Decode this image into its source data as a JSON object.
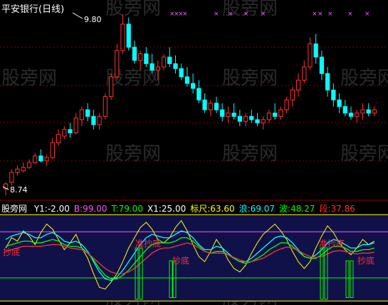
{
  "title": "平安银行(日线)",
  "price_panel": {
    "high_label": "9.80",
    "low_label": "8.74"
  },
  "indicator_panel": {
    "name": "股旁网",
    "values": [
      {
        "label": "Y1:",
        "value": "-2.00",
        "color": "#ffffff"
      },
      {
        "label": "B:",
        "value": "99.00",
        "color": "#ff55ff"
      },
      {
        "label": "T:",
        "value": "79.00",
        "color": "#00ff00"
      },
      {
        "label": "X1:",
        "value": "25.00",
        "color": "#ffffff"
      },
      {
        "label": "标尺:",
        "value": "63.60",
        "color": "#ffff00"
      },
      {
        "label": "浪:",
        "value": "69.07",
        "color": "#00ffff"
      },
      {
        "label": "波:",
        "value": "48.27",
        "color": "#00ff00"
      },
      {
        "label": "段:",
        "value": "37.86",
        "color": "#ff3030"
      }
    ],
    "annotations": [
      "抄底",
      "准抄底",
      "抄底",
      "准抄底",
      "抄底"
    ]
  },
  "watermark": "股旁网",
  "colors": {
    "up": "#ff3232",
    "down": "#00ffff",
    "grid": "#8b0000",
    "yellow": "#ffff00",
    "magenta": "#ff55ff"
  },
  "chart_data": {
    "type": "candlestick",
    "ylim": [
      8.74,
      9.8
    ],
    "candles": [
      [
        8.74,
        8.78,
        8.7,
        8.77
      ],
      [
        8.78,
        8.86,
        8.76,
        8.84
      ],
      [
        8.84,
        8.88,
        8.82,
        8.86
      ],
      [
        8.85,
        8.9,
        8.84,
        8.87
      ],
      [
        8.87,
        8.92,
        8.86,
        8.9
      ],
      [
        8.9,
        8.96,
        8.89,
        8.94
      ],
      [
        8.94,
        8.98,
        8.9,
        8.91
      ],
      [
        8.91,
        8.95,
        8.88,
        8.93
      ],
      [
        8.93,
        9.05,
        8.92,
        9.02
      ],
      [
        9.02,
        9.1,
        9.0,
        9.07
      ],
      [
        9.06,
        9.12,
        9.04,
        9.1
      ],
      [
        9.1,
        9.14,
        9.05,
        9.08
      ],
      [
        9.08,
        9.2,
        9.07,
        9.17
      ],
      [
        9.16,
        9.24,
        9.12,
        9.22
      ],
      [
        9.22,
        9.26,
        9.15,
        9.18
      ],
      [
        9.18,
        9.22,
        9.1,
        9.13
      ],
      [
        9.13,
        9.2,
        9.1,
        9.18
      ],
      [
        9.18,
        9.32,
        9.16,
        9.3
      ],
      [
        9.3,
        9.44,
        9.28,
        9.42
      ],
      [
        9.42,
        9.62,
        9.4,
        9.58
      ],
      [
        9.58,
        9.8,
        9.56,
        9.74
      ],
      [
        9.74,
        9.78,
        9.58,
        9.6
      ],
      [
        9.6,
        9.64,
        9.5,
        9.52
      ],
      [
        9.52,
        9.58,
        9.46,
        9.56
      ],
      [
        9.56,
        9.6,
        9.48,
        9.5
      ],
      [
        9.5,
        9.56,
        9.44,
        9.46
      ],
      [
        9.46,
        9.52,
        9.4,
        9.48
      ],
      [
        9.48,
        9.56,
        9.46,
        9.54
      ],
      [
        9.54,
        9.6,
        9.48,
        9.5
      ],
      [
        9.5,
        9.55,
        9.44,
        9.47
      ],
      [
        9.47,
        9.5,
        9.4,
        9.42
      ],
      [
        9.42,
        9.48,
        9.36,
        9.38
      ],
      [
        9.38,
        9.44,
        9.32,
        9.35
      ],
      [
        9.35,
        9.4,
        9.26,
        9.28
      ],
      [
        9.28,
        9.32,
        9.2,
        9.22
      ],
      [
        9.22,
        9.28,
        9.18,
        9.26
      ],
      [
        9.26,
        9.3,
        9.2,
        9.22
      ],
      [
        9.22,
        9.26,
        9.15,
        9.18
      ],
      [
        9.18,
        9.24,
        9.14,
        9.2
      ],
      [
        9.2,
        9.26,
        9.16,
        9.18
      ],
      [
        9.18,
        9.22,
        9.12,
        9.15
      ],
      [
        9.15,
        9.2,
        9.12,
        9.18
      ],
      [
        9.18,
        9.22,
        9.14,
        9.16
      ],
      [
        9.16,
        9.2,
        9.12,
        9.14
      ],
      [
        9.14,
        9.18,
        9.1,
        9.16
      ],
      [
        9.16,
        9.22,
        9.14,
        9.2
      ],
      [
        9.2,
        9.26,
        9.16,
        9.18
      ],
      [
        9.18,
        9.24,
        9.16,
        9.22
      ],
      [
        9.22,
        9.3,
        9.2,
        9.28
      ],
      [
        9.28,
        9.36,
        9.24,
        9.34
      ],
      [
        9.34,
        9.44,
        9.3,
        9.4
      ],
      [
        9.4,
        9.52,
        9.38,
        9.48
      ],
      [
        9.48,
        9.66,
        9.46,
        9.62
      ],
      [
        9.62,
        9.68,
        9.5,
        9.54
      ],
      [
        9.54,
        9.58,
        9.4,
        9.44
      ],
      [
        9.44,
        9.48,
        9.3,
        9.34
      ],
      [
        9.34,
        9.38,
        9.24,
        9.28
      ],
      [
        9.28,
        9.32,
        9.2,
        9.24
      ],
      [
        9.24,
        9.28,
        9.18,
        9.2
      ],
      [
        9.2,
        9.24,
        9.16,
        9.18
      ],
      [
        9.18,
        9.22,
        9.14,
        9.2
      ],
      [
        9.2,
        9.26,
        9.16,
        9.22
      ],
      [
        9.22,
        9.26,
        9.18,
        9.2
      ],
      [
        9.2,
        9.24,
        9.18,
        9.22
      ]
    ],
    "indicator": {
      "ylim": [
        0,
        100
      ],
      "levels": [
        -2.0,
        25.0,
        79.0,
        99.0
      ],
      "series": [
        {
          "name": "标尺",
          "values": [
            60,
            72,
            68,
            80,
            74,
            64,
            78,
            88,
            82,
            70,
            58,
            66,
            76,
            60,
            48,
            30,
            14,
            12,
            20,
            30,
            44,
            60,
            72,
            84,
            90,
            82,
            70,
            66,
            72,
            84,
            92,
            80,
            64,
            50,
            44,
            56,
            70,
            60,
            46,
            36,
            32,
            40,
            54,
            66,
            76,
            82,
            88,
            80,
            70,
            56,
            44,
            36,
            44,
            60,
            74,
            86,
            78,
            66,
            58,
            52,
            60,
            70,
            64,
            68
          ]
        },
        {
          "name": "浪",
          "values": [
            70,
            74,
            76,
            78,
            76,
            72,
            72,
            76,
            78,
            74,
            68,
            66,
            68,
            64,
            56,
            44,
            32,
            24,
            22,
            26,
            34,
            44,
            54,
            64,
            72,
            76,
            74,
            72,
            72,
            76,
            80,
            78,
            72,
            64,
            58,
            58,
            62,
            60,
            54,
            48,
            44,
            44,
            48,
            54,
            60,
            66,
            72,
            74,
            72,
            66,
            58,
            50,
            48,
            52,
            58,
            66,
            70,
            68,
            64,
            60,
            60,
            64,
            64,
            66
          ]
        },
        {
          "name": "波",
          "values": [
            62,
            64,
            66,
            68,
            68,
            66,
            66,
            68,
            70,
            68,
            64,
            62,
            62,
            60,
            54,
            46,
            36,
            28,
            24,
            24,
            28,
            34,
            42,
            50,
            58,
            64,
            66,
            66,
            66,
            68,
            72,
            72,
            68,
            62,
            56,
            54,
            56,
            56,
            52,
            48,
            44,
            42,
            44,
            48,
            52,
            58,
            62,
            66,
            66,
            62,
            56,
            50,
            48,
            48,
            52,
            58,
            62,
            62,
            60,
            56,
            56,
            58,
            58,
            60
          ]
        },
        {
          "name": "段",
          "values": [
            56,
            58,
            60,
            62,
            62,
            62,
            62,
            63,
            64,
            64,
            62,
            60,
            59,
            58,
            54,
            48,
            42,
            36,
            32,
            30,
            30,
            32,
            36,
            42,
            48,
            54,
            58,
            60,
            60,
            62,
            64,
            66,
            64,
            60,
            56,
            54,
            54,
            54,
            52,
            49,
            46,
            44,
            44,
            46,
            48,
            52,
            56,
            59,
            61,
            60,
            57,
            53,
            50,
            49,
            50,
            53,
            56,
            57,
            56,
            54,
            53,
            54,
            54,
            55
          ]
        }
      ]
    }
  }
}
